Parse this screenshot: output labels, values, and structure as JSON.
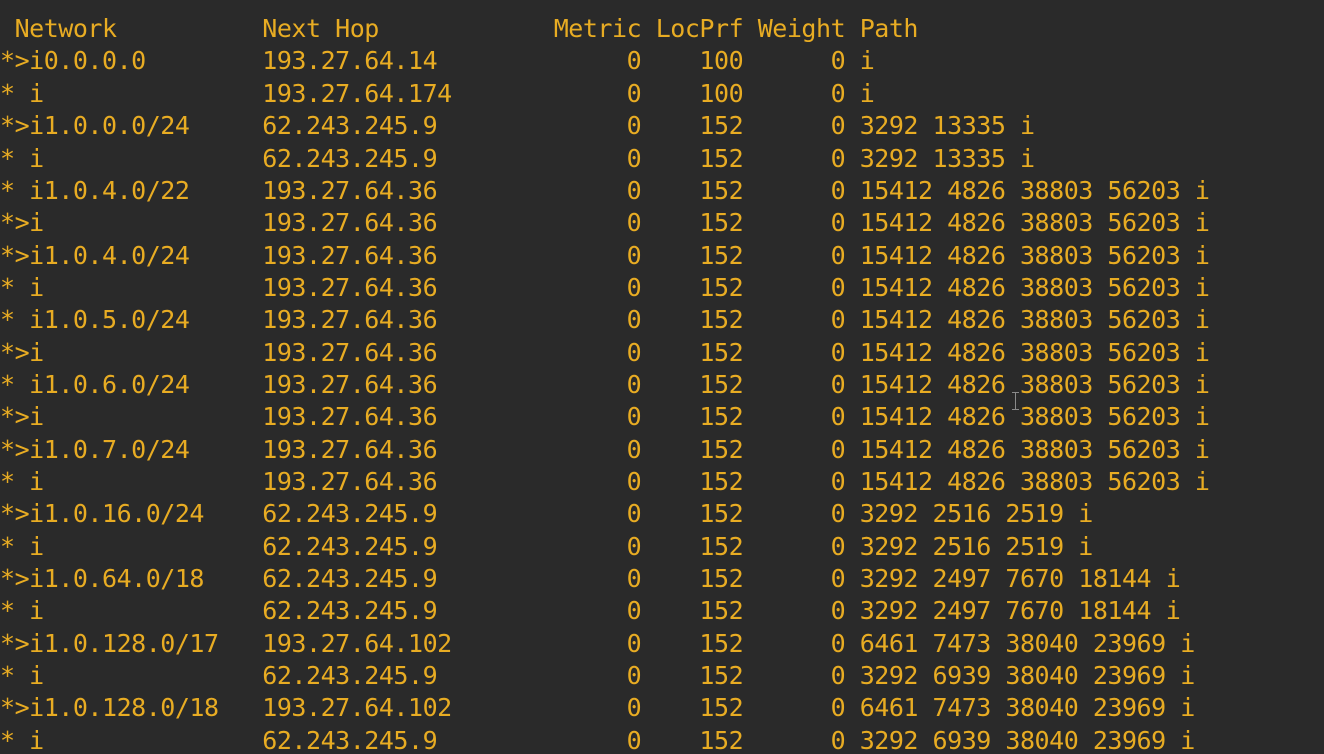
{
  "terminal": {
    "header": " Network          Next Hop            Metric LocPrf Weight Path",
    "rows": [
      "*>i0.0.0.0        193.27.64.14             0    100      0 i",
      "* i               193.27.64.174            0    100      0 i",
      "*>i1.0.0.0/24     62.243.245.9             0    152      0 3292 13335 i",
      "* i               62.243.245.9             0    152      0 3292 13335 i",
      "* i1.0.4.0/22     193.27.64.36             0    152      0 15412 4826 38803 56203 i",
      "*>i               193.27.64.36             0    152      0 15412 4826 38803 56203 i",
      "*>i1.0.4.0/24     193.27.64.36             0    152      0 15412 4826 38803 56203 i",
      "* i               193.27.64.36             0    152      0 15412 4826 38803 56203 i",
      "* i1.0.5.0/24     193.27.64.36             0    152      0 15412 4826 38803 56203 i",
      "*>i               193.27.64.36             0    152      0 15412 4826 38803 56203 i",
      "* i1.0.6.0/24     193.27.64.36             0    152      0 15412 4826 38803 56203 i",
      "*>i               193.27.64.36             0    152      0 15412 4826 38803 56203 i",
      "*>i1.0.7.0/24     193.27.64.36             0    152      0 15412 4826 38803 56203 i",
      "* i               193.27.64.36             0    152      0 15412 4826 38803 56203 i",
      "*>i1.0.16.0/24    62.243.245.9             0    152      0 3292 2516 2519 i",
      "* i               62.243.245.9             0    152      0 3292 2516 2519 i",
      "*>i1.0.64.0/18    62.243.245.9             0    152      0 3292 2497 7670 18144 i",
      "* i               62.243.245.9             0    152      0 3292 2497 7670 18144 i",
      "*>i1.0.128.0/17   193.27.64.102            0    152      0 6461 7473 38040 23969 i",
      "* i               62.243.245.9             0    152      0 3292 6939 38040 23969 i",
      "*>i1.0.128.0/18   193.27.64.102            0    152      0 6461 7473 38040 23969 i",
      "* i               62.243.245.9             0    152      0 3292 6939 38040 23969 i"
    ]
  },
  "colors": {
    "background": "#2a2a2a",
    "text": "#e8ac23"
  },
  "icons": {
    "cursor": "i-beam-cursor-icon"
  }
}
